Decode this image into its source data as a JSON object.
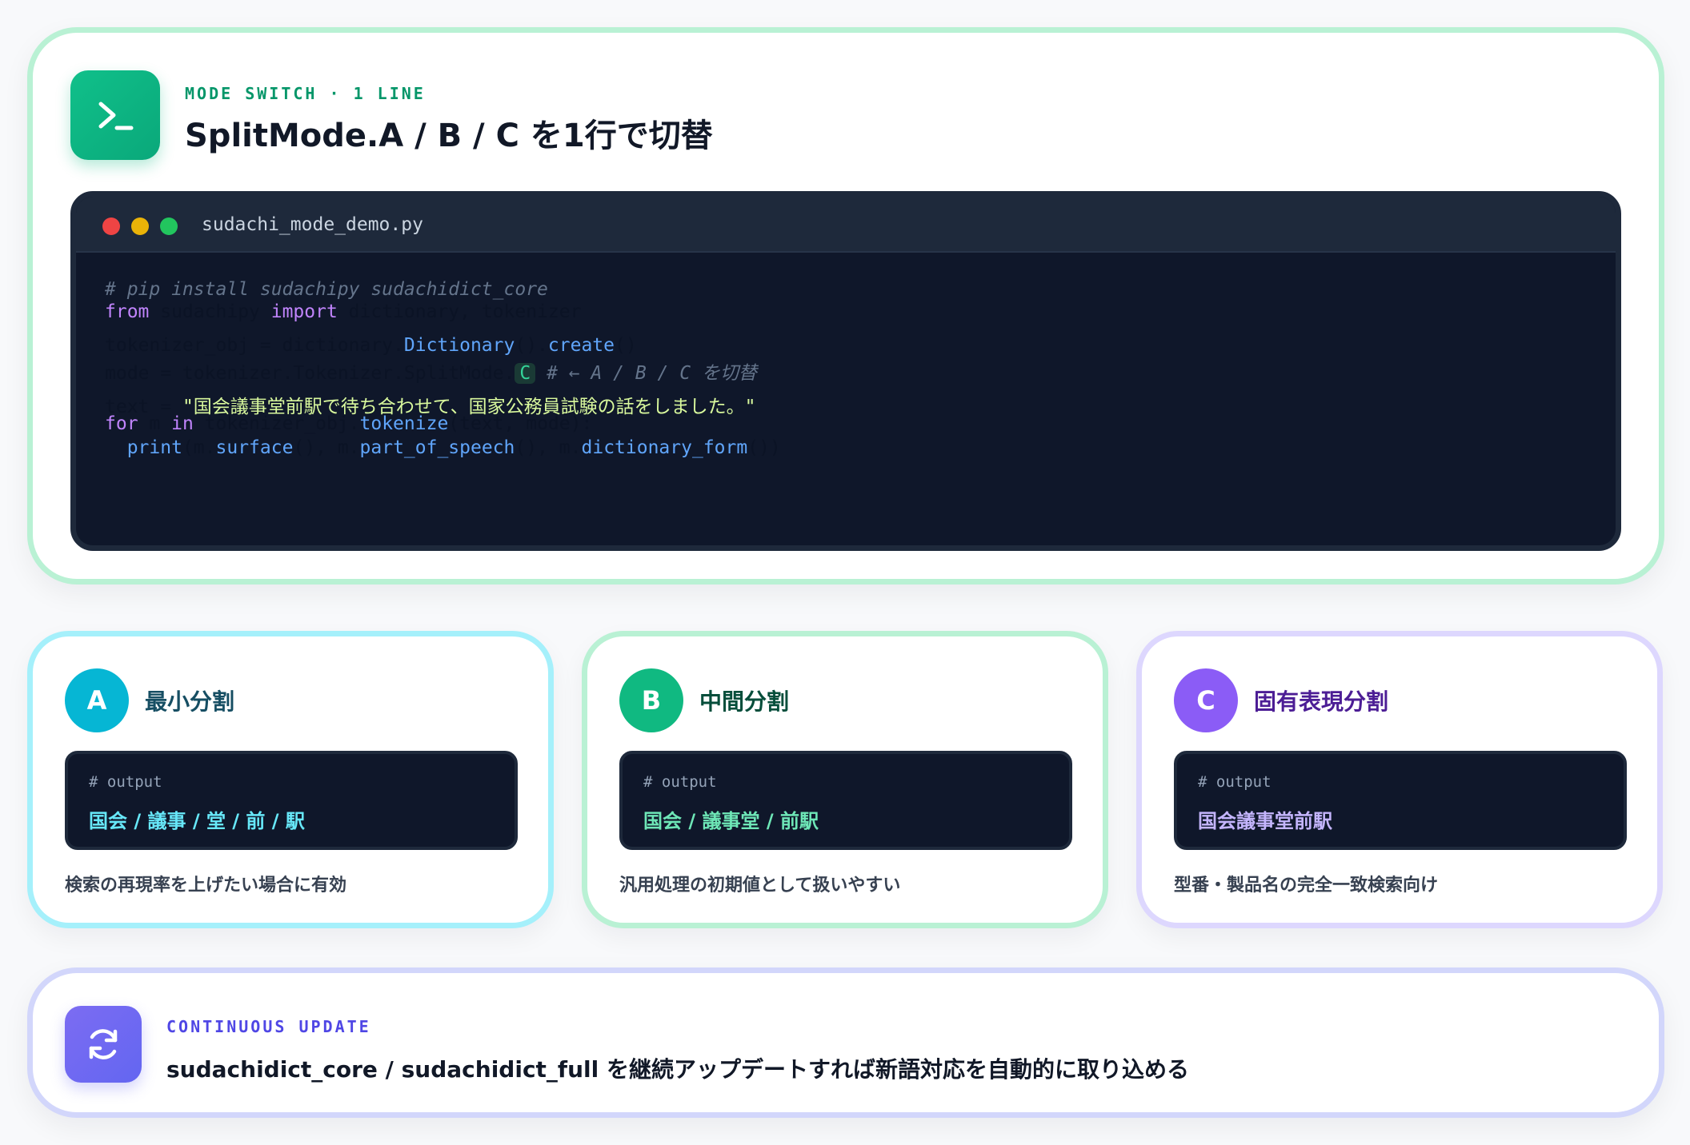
{
  "header": {
    "eyebrow": "MODE SWITCH · 1 LINE",
    "title": "SplitMode.A / B / C を1行で切替",
    "icon": "terminal-icon"
  },
  "code_window": {
    "filename": "sudachi_mode_demo.py",
    "window_dots": [
      "#ef4444",
      "#eab308",
      "#22c55e"
    ],
    "lines": {
      "l1": {
        "comment": "# pip install sudachipy sudachidict_core"
      },
      "l2": {
        "kw_from": "from",
        "module": " sudachipy ",
        "kw_import": "import",
        "names": " dictionary, tokenizer"
      },
      "l3": {
        "pre": "tokenizer_obj = dictionary.",
        "cls": "Dictionary",
        "mid": "().",
        "method": "create",
        "post": "()"
      },
      "l4": {
        "pre": "mode = tokenizer.Tokenizer.SplitMode.",
        "mode": "C",
        "comment": " # ← A / B / C を切替"
      },
      "l5": {
        "pre": "text = ",
        "string": "\"国会議事堂前駅で待ち合わせて、国家公務員試験の話をしました。\""
      },
      "l6": {
        "kw_for": "for",
        "var": " m ",
        "kw_in": "in",
        "pre": " tokenizer_obj.",
        "method": "tokenize",
        "post": "(text, mode):"
      },
      "l7": {
        "indent": "  ",
        "fn_print": "print",
        "a": "(m.",
        "m1": "surface",
        "b": "(), m.",
        "m2": "part_of_speech",
        "c": "(), m.",
        "m3": "dictionary_form",
        "d": "())"
      }
    }
  },
  "modes": [
    {
      "badge": "A",
      "title": "最小分割",
      "output_label": "# output",
      "output": "国会 / 議事 / 堂 / 前 / 駅",
      "description": "検索の再現率を上げたい場合に有効",
      "color": "#06b6d4"
    },
    {
      "badge": "B",
      "title": "中間分割",
      "output_label": "# output",
      "output": "国会 / 議事堂 / 前駅",
      "description": "汎用処理の初期値として扱いやすい",
      "color": "#10b981"
    },
    {
      "badge": "C",
      "title": "固有表現分割",
      "output_label": "# output",
      "output": "国会議事堂前駅",
      "description": "型番・製品名の完全一致検索向け",
      "color": "#8b5cf6"
    }
  ],
  "update": {
    "eyebrow": "CONTINUOUS UPDATE",
    "text": "sudachidict_core / sudachidict_full を継続アップデートすれば新語対応を自動的に取り込める",
    "icon": "refresh-icon"
  },
  "colors": {
    "accent_green": "#10b981",
    "accent_indigo": "#6366f1",
    "code_bg": "#0f172a"
  }
}
